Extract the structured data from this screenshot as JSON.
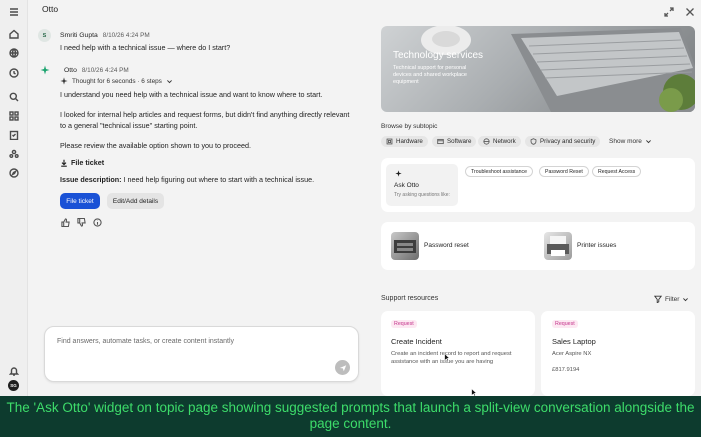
{
  "app": {
    "title": "Otto"
  },
  "rail": {
    "icons": [
      "menu-icon",
      "home-icon",
      "globe-icon",
      "history-icon",
      "search-icon",
      "apps-icon",
      "clipboard-icon",
      "people-icon",
      "compass-icon",
      "bell-icon"
    ],
    "avatar_initials": "SG"
  },
  "conversation": {
    "user": {
      "initial": "S",
      "name": "Smriti Gupta",
      "timestamp": "8/10/26 4:24 PM",
      "text": "I need help with a technical issue — where do I start?"
    },
    "bot": {
      "name": "Otto",
      "timestamp": "8/10/26 4:24 PM",
      "thought": "Thought for 6 seconds · 6 steps",
      "paragraphs": [
        "I understand you need help with a technical issue and want to know where to start.",
        "I looked for internal help articles and request forms, but didn't find anything directly relevant",
        "to a general \"technical issue\" starting point.",
        "Please review the available option shown to you to proceed."
      ],
      "ticket_heading": "File ticket",
      "issue_label": "Issue description:",
      "issue_text": "I need help figuring out where to start with a technical issue.",
      "primary_button": "File ticket",
      "secondary_button": "Edit/Add details"
    }
  },
  "composer": {
    "placeholder": "Find answers, automate tasks, or create content instantly"
  },
  "topic": {
    "hero_title": "Technology services",
    "hero_desc": "Technical support for personal devices and shared workplace equipment",
    "browse_label": "Browse by subtopic",
    "subtopics": [
      {
        "label": "Hardware",
        "icon": "hardware-icon"
      },
      {
        "label": "Software",
        "icon": "software-icon"
      },
      {
        "label": "Network",
        "icon": "network-icon"
      },
      {
        "label": "Privacy and security",
        "icon": "shield-icon"
      }
    ],
    "show_more": "Show more",
    "ask": {
      "title": "Ask Otto",
      "subtitle": "Try asking questions like:",
      "prompts": [
        "Troubleshoot assistance",
        "Password Reset",
        "Request Access"
      ]
    },
    "articles": [
      {
        "label": "Password reset"
      },
      {
        "label": "Printer issues"
      }
    ],
    "support_label": "Support resources",
    "filter_label": "Filter",
    "resources": [
      {
        "badge": "Request",
        "title": "Create Incident",
        "desc": "Create an incident record to report and request assistance with an issue you are having"
      },
      {
        "badge": "Request",
        "title": "Sales Laptop",
        "subtitle": "Acer Aspire NX",
        "price": "£817.9194"
      }
    ]
  },
  "caption": "The 'Ask Otto' widget on topic page showing suggested prompts that launch a split-view conversation alongside the page content."
}
